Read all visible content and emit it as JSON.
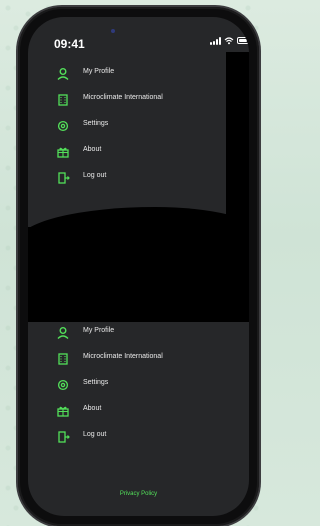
{
  "status": {
    "time": "09:41"
  },
  "menu_top": [
    {
      "label": "My Profile",
      "icon": "user-icon"
    },
    {
      "label": "Microclimate International",
      "icon": "building-icon"
    },
    {
      "label": "Settings",
      "icon": "gear-icon"
    },
    {
      "label": "About",
      "icon": "gift-icon"
    },
    {
      "label": "Log out",
      "icon": "logout-icon"
    }
  ],
  "menu_bottom": [
    {
      "label": "My Profile",
      "icon": "user-icon"
    },
    {
      "label": "Microclimate International",
      "icon": "building-icon"
    },
    {
      "label": "Settings",
      "icon": "gear-icon"
    },
    {
      "label": "About",
      "icon": "gift-icon"
    },
    {
      "label": "Log out",
      "icon": "logout-icon"
    }
  ],
  "footer": {
    "privacy_link": "Privacy Policy"
  },
  "colors": {
    "accent_green": "#53e05a",
    "screen_bg": "#262729",
    "black": "#000000"
  }
}
